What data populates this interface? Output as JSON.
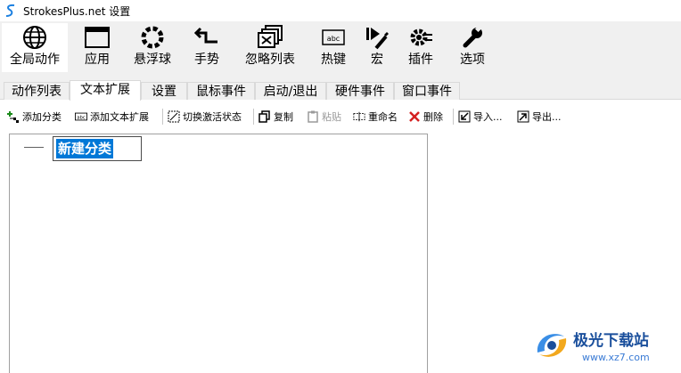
{
  "window": {
    "title": "StrokesPlus.net 设置"
  },
  "main_toolbar": [
    {
      "label": "全局动作",
      "icon": "globe-icon"
    },
    {
      "label": "应用",
      "icon": "window-icon"
    },
    {
      "label": "悬浮球",
      "icon": "ring-icon"
    },
    {
      "label": "手势",
      "icon": "gesture-arrow-icon"
    },
    {
      "label": "忽略列表",
      "icon": "stacked-windows-icon"
    },
    {
      "label": "热键",
      "icon": "keyboard-abc-icon"
    },
    {
      "label": "宏",
      "icon": "macro-play-icon"
    },
    {
      "label": "插件",
      "icon": "plugin-gear-icon"
    },
    {
      "label": "选项",
      "icon": "wrench-icon"
    }
  ],
  "tabs": [
    {
      "label": "动作列表"
    },
    {
      "label": "文本扩展"
    },
    {
      "label": "设置"
    },
    {
      "label": "鼠标事件"
    },
    {
      "label": "启动/退出"
    },
    {
      "label": "硬件事件"
    },
    {
      "label": "窗口事件"
    }
  ],
  "sub_toolbar": {
    "add_category": "添加分类",
    "add_text_expansion": "添加文本扩展",
    "toggle_active": "切换激活状态",
    "copy": "复制",
    "paste": "粘贴",
    "rename": "重命名",
    "delete": "删除",
    "import": "导入...",
    "export": "导出..."
  },
  "tree": {
    "editing_node_text": "新建分类"
  },
  "watermark": {
    "main": "极光下载站",
    "url": "www.xz7.com"
  },
  "colors": {
    "selection": "#0078d7",
    "delete_red": "#d42020"
  }
}
